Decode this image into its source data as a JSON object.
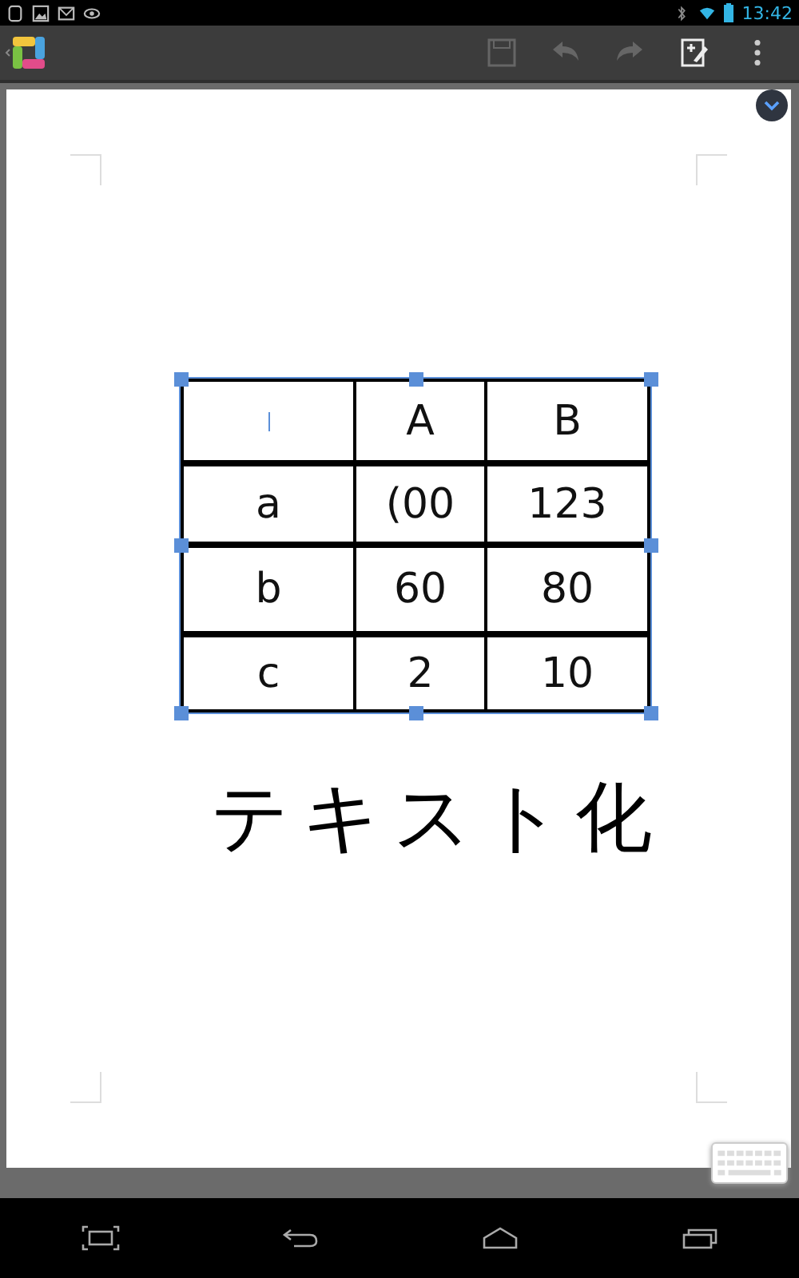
{
  "status_bar": {
    "time": "13:42"
  },
  "table": {
    "rows": [
      {
        "cells": [
          {
            "text": null,
            "cursor": true
          },
          {
            "text": "A",
            "cursor": false
          },
          {
            "text": "B",
            "cursor": false
          }
        ]
      },
      {
        "cells": [
          {
            "text": "a",
            "cursor": false
          },
          {
            "text": "(00",
            "cursor": false
          },
          {
            "text": "123",
            "cursor": false
          }
        ]
      },
      {
        "cells": [
          {
            "text": "b",
            "cursor": false
          },
          {
            "text": "60",
            "cursor": false
          },
          {
            "text": "80",
            "cursor": false
          }
        ]
      },
      {
        "cells": [
          {
            "text": "c",
            "cursor": false
          },
          {
            "text": "2",
            "cursor": false
          },
          {
            "text": "10",
            "cursor": false
          }
        ]
      }
    ],
    "selected": true
  },
  "handwriting": {
    "text": "テキスト化"
  }
}
